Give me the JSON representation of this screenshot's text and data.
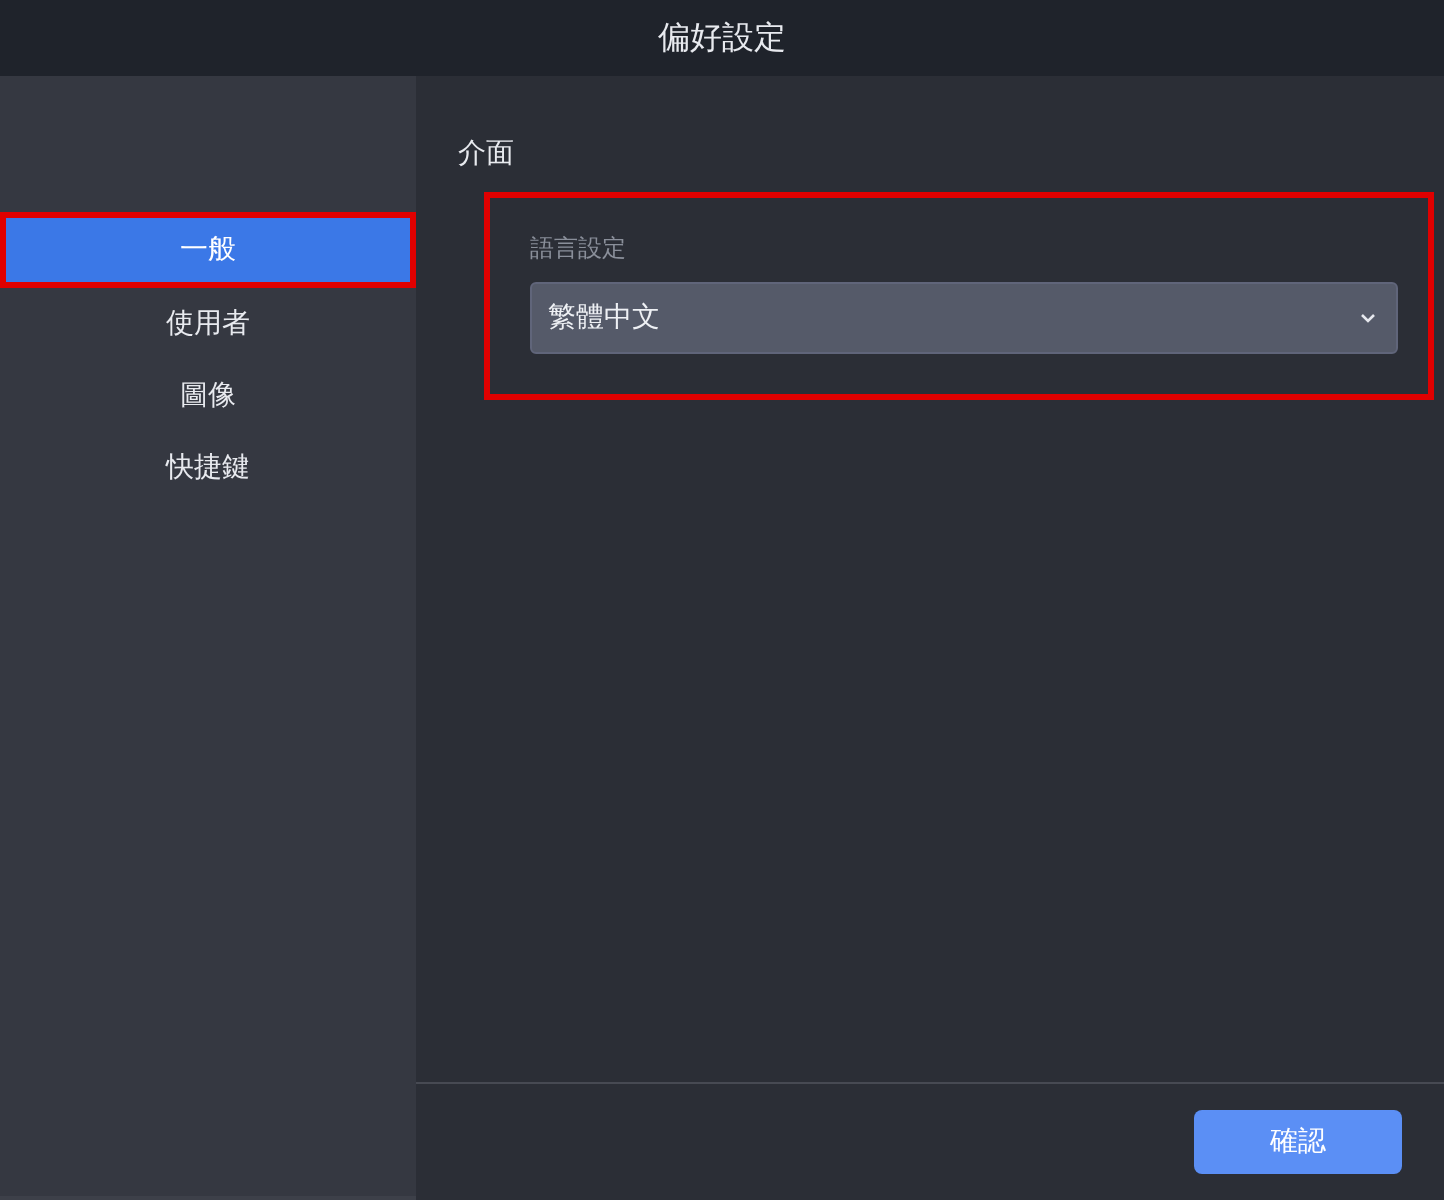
{
  "window": {
    "title": "偏好設定"
  },
  "sidebar": {
    "items": [
      {
        "label": "一般",
        "selected": true,
        "highlighted": true
      },
      {
        "label": "使用者",
        "selected": false,
        "highlighted": false
      },
      {
        "label": "圖像",
        "selected": false,
        "highlighted": false
      },
      {
        "label": "快捷鍵",
        "selected": false,
        "highlighted": false
      }
    ]
  },
  "section": {
    "title": "介面",
    "highlighted": true,
    "field": {
      "label": "語言設定",
      "value": "繁體中文"
    }
  },
  "buttons": [
    {
      "label": "確認",
      "kind": "primary"
    }
  ]
}
